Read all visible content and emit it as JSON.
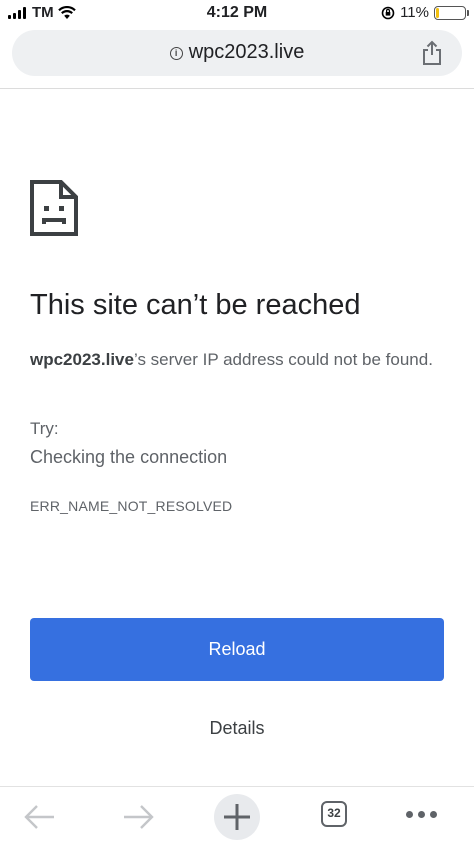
{
  "status_bar": {
    "carrier": "TM",
    "time": "4:12 PM",
    "battery_percent": "11%",
    "battery_level": 0.11,
    "icons": [
      "signal-icon",
      "wifi-icon",
      "rotation-lock-icon",
      "battery-icon"
    ]
  },
  "address_bar": {
    "url": "wpc2023.live",
    "icons": [
      "info-icon",
      "share-icon"
    ]
  },
  "error_page": {
    "icon": "sad-page-icon",
    "headline": "This site can’t be reached",
    "message_host": "wpc2023.live",
    "message_rest": "’s server IP address could not be found.",
    "try_label": "Try:",
    "suggestion": "Checking the connection",
    "error_code": "ERR_NAME_NOT_RESOLVED",
    "reload_label": "Reload",
    "details_label": "Details"
  },
  "toolbar": {
    "tab_count": "32",
    "icons": [
      "back-arrow-icon",
      "forward-arrow-icon",
      "plus-icon",
      "tab-switcher-icon",
      "more-icon"
    ]
  },
  "colors": {
    "accent": "#3670e0",
    "battery_low": "#f2c010",
    "text_secondary": "#5f6368"
  }
}
